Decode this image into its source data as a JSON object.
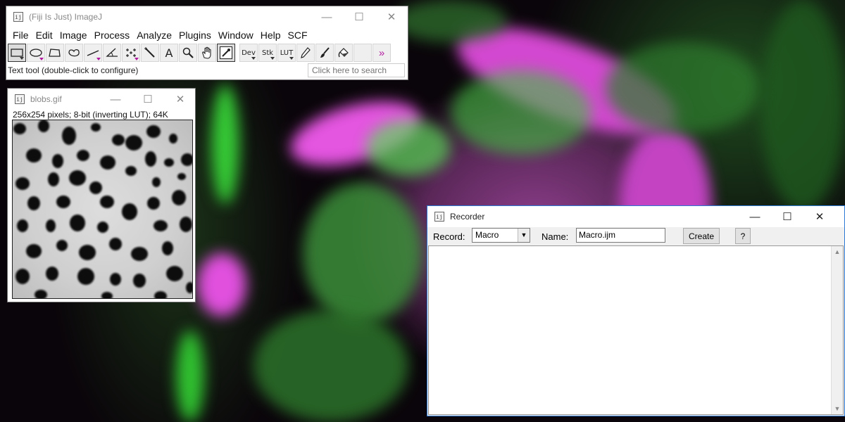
{
  "imagej": {
    "title": "(Fiji Is Just) ImageJ",
    "menus": [
      "File",
      "Edit",
      "Image",
      "Process",
      "Analyze",
      "Plugins",
      "Window",
      "Help",
      "SCF"
    ],
    "tools": {
      "text_tool_glyph": "A",
      "dev_label": "Dev",
      "stk_label": "Stk",
      "lut_label": "LUT",
      "more_glyph": "»"
    },
    "status_text": "Text tool (double-click to configure)",
    "search_placeholder": "Click here to search"
  },
  "blobs_window": {
    "title": "blobs.gif",
    "info": "256x254 pixels; 8-bit (inverting LUT); 64K"
  },
  "recorder": {
    "title": "Recorder",
    "record_label": "Record:",
    "record_value": "Macro",
    "name_label": "Name:",
    "name_value": "Macro.ijm",
    "create_label": "Create",
    "help_label": "?"
  },
  "window_controls": {
    "minimize": "—",
    "maximize": "☐",
    "close": "✕"
  },
  "colors": {
    "wallpaper_green": "#3ddc3d",
    "wallpaper_magenta": "#e24ee0",
    "recorder_border": "#2b79d4"
  }
}
